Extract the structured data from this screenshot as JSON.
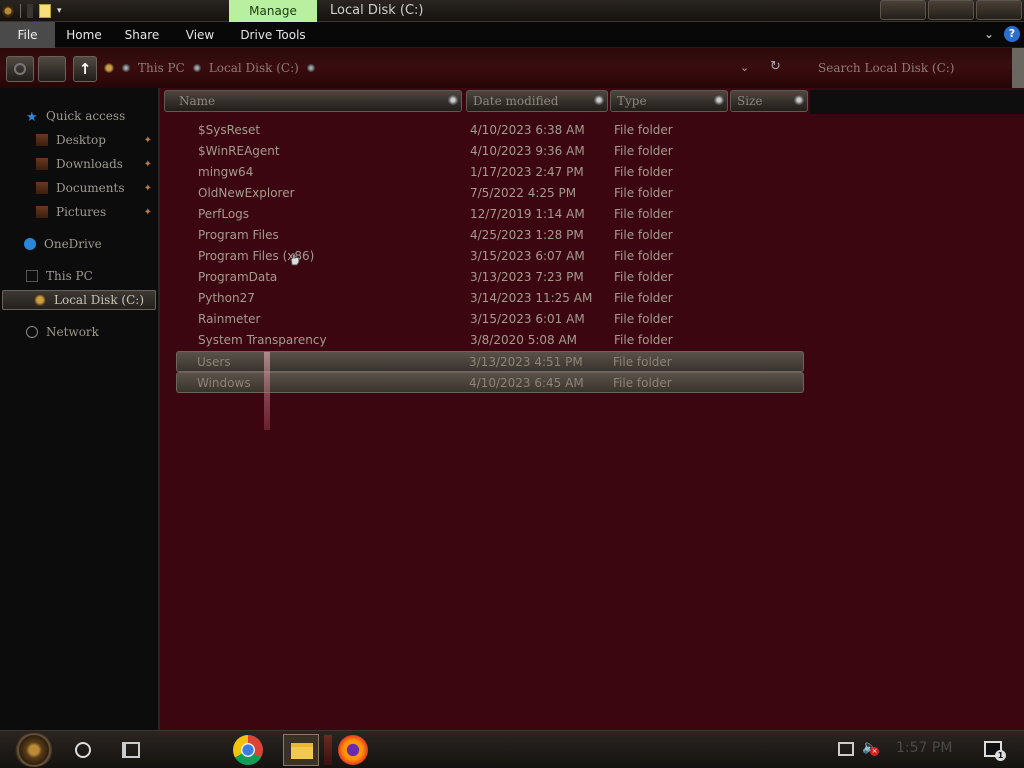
{
  "titlebar": {
    "manage_tab": "Manage",
    "title": "Local Disk (C:)"
  },
  "ribbon": {
    "tabs": [
      "File",
      "Home",
      "Share",
      "View",
      "Drive Tools"
    ]
  },
  "address": {
    "crumbs": [
      "This PC",
      "Local Disk (C:)"
    ],
    "search_placeholder": "Search Local Disk (C:)"
  },
  "nav": {
    "quick_access": "Quick access",
    "items": [
      "Desktop",
      "Downloads",
      "Documents",
      "Pictures"
    ],
    "onedrive": "OneDrive",
    "this_pc": "This PC",
    "local_disk": "Local Disk (C:)",
    "network": "Network"
  },
  "columns": {
    "name": "Name",
    "date": "Date modified",
    "type": "Type",
    "size": "Size"
  },
  "files": [
    {
      "name": "$SysReset",
      "date": "4/10/2023 6:38 AM",
      "type": "File folder"
    },
    {
      "name": "$WinREAgent",
      "date": "4/10/2023 9:36 AM",
      "type": "File folder"
    },
    {
      "name": "mingw64",
      "date": "1/17/2023 2:47 PM",
      "type": "File folder"
    },
    {
      "name": "OldNewExplorer",
      "date": "7/5/2022 4:25 PM",
      "type": "File folder"
    },
    {
      "name": "PerfLogs",
      "date": "12/7/2019 1:14 AM",
      "type": "File folder"
    },
    {
      "name": "Program Files",
      "date": "4/25/2023 1:28 PM",
      "type": "File folder"
    },
    {
      "name": "Program Files (x86)",
      "date": "3/15/2023 6:07 AM",
      "type": "File folder"
    },
    {
      "name": "ProgramData",
      "date": "3/13/2023 7:23 PM",
      "type": "File folder"
    },
    {
      "name": "Python27",
      "date": "3/14/2023 11:25 AM",
      "type": "File folder"
    },
    {
      "name": "Rainmeter",
      "date": "3/15/2023 6:01 AM",
      "type": "File folder"
    },
    {
      "name": "System Transparency",
      "date": "3/8/2020 5:08 AM",
      "type": "File folder"
    },
    {
      "name": "Users",
      "date": "3/13/2023 4:51 PM",
      "type": "File folder",
      "selected": true
    },
    {
      "name": "Windows",
      "date": "4/10/2023 6:45 AM",
      "type": "File folder",
      "selected": true
    }
  ],
  "taskbar": {
    "time": "1:57 PM",
    "notification_count": "1"
  }
}
